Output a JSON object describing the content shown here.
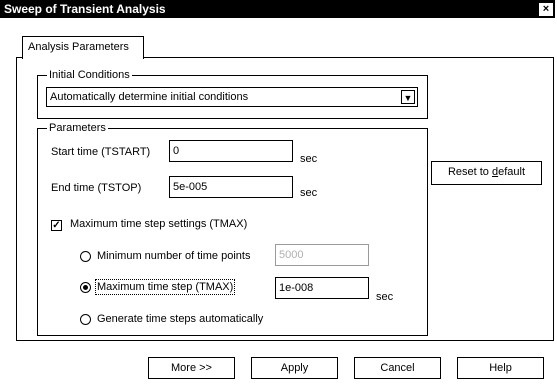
{
  "window": {
    "title": "Sweep of Transient Analysis",
    "close_glyph": "×"
  },
  "tabs": [
    {
      "label": "Analysis Parameters"
    }
  ],
  "initial_conditions": {
    "legend": "Initial Conditions",
    "selected": "Automatically determine initial conditions",
    "arrow": "▼"
  },
  "parameters": {
    "legend": "Parameters",
    "start_time": {
      "label": "Start time (TSTART)",
      "value": "0",
      "unit": "sec"
    },
    "end_time": {
      "label": "End time (TSTOP)",
      "value": "5e-005",
      "unit": "sec"
    },
    "tmax_checkbox": {
      "label": "Maximum time step settings (TMAX)",
      "checked": true,
      "mark": "✓"
    },
    "radio_min_points": {
      "label": "Minimum number of time points",
      "value": "5000",
      "checked": false
    },
    "radio_max_step": {
      "label": "Maximum time step (TMAX)",
      "value": "1e-008",
      "unit": "sec",
      "checked": true
    },
    "radio_auto": {
      "label": "Generate time steps automatically",
      "checked": false
    }
  },
  "reset_button": {
    "label_prefix": "Reset to ",
    "label_underlined": "d",
    "label_suffix": "efault"
  },
  "buttons": {
    "more": "More >>",
    "apply": "Apply",
    "cancel": "Cancel",
    "help": "Help"
  }
}
